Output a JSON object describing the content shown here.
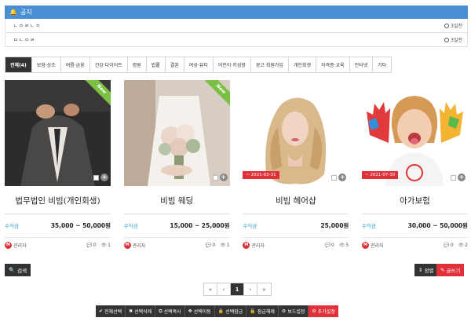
{
  "notice": {
    "header": "공지",
    "items": [
      {
        "title": "ㄴㅇㄹㄴㅇ",
        "ago": "3일전"
      },
      {
        "title": "ㅁㄴㅇㄹ",
        "ago": "3일전"
      }
    ]
  },
  "tabs": [
    "전체(4)",
    "보험·상조",
    "여름·금융",
    "건강·다이어트",
    "병원",
    "법률",
    "결혼",
    "여성·뷰티",
    "어린이·키성장",
    "광고·회원가입",
    "개인회생",
    "자격증·교육",
    "인터넷",
    "기타"
  ],
  "cards": [
    {
      "title": "법무법인 비빔(개인회생)",
      "badge": "New",
      "date": "",
      "price_label": "수익금",
      "price": "35,000 ~ 50,000원",
      "author": "관리자",
      "comments": "0",
      "views": "1"
    },
    {
      "title": "비빔 웨딩",
      "badge": "New",
      "date": "",
      "price_label": "수익금",
      "price": "15,000 ~ 25,000원",
      "author": "관리자",
      "comments": "0",
      "views": "1"
    },
    {
      "title": "비빔 헤어샵",
      "badge": "",
      "date": "~ 2021-03-31",
      "price_label": "수익금",
      "price": "25,000원",
      "author": "관리자",
      "comments": "0",
      "views": "5"
    },
    {
      "title": "아가보험",
      "badge": "",
      "date": "~ 2021-07-30",
      "price_label": "수익금",
      "price": "30,000 ~ 50,000원",
      "author": "관리자",
      "comments": "0",
      "views": "2"
    }
  ],
  "buttons": {
    "search": "검색",
    "sort": "정렬",
    "write": "글쓰기"
  },
  "pager": {
    "first": "«",
    "prev": "‹",
    "current": "1",
    "next": "›",
    "last": "»"
  },
  "admin": [
    "전체선택",
    "선택삭제",
    "선택복사",
    "선택이동",
    "선택잠금",
    "잠금해제",
    "보드설정",
    "추가설정"
  ]
}
